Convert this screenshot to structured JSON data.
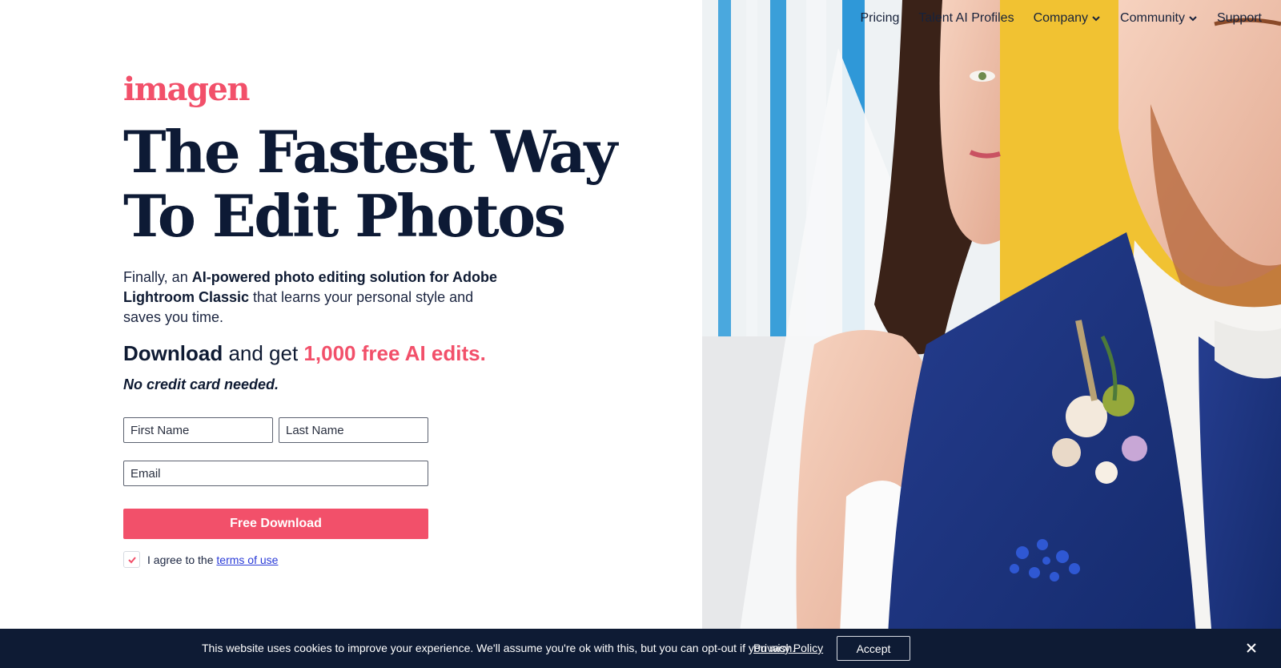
{
  "nav": {
    "items": [
      {
        "label": "Pricing",
        "dropdown": false
      },
      {
        "label": "Talent AI Profiles",
        "dropdown": false
      },
      {
        "label": "Company",
        "dropdown": true
      },
      {
        "label": "Community",
        "dropdown": true
      },
      {
        "label": "Support",
        "dropdown": false
      }
    ]
  },
  "brand": {
    "logo_text": "imagen",
    "accent_color": "#f2506a",
    "dark_color": "#0e1b34"
  },
  "hero": {
    "headline_line1": "The Fastest Way",
    "headline_line2": "To Edit Photos",
    "intro_part1": "Finally, an ",
    "intro_bold": "AI-powered photo editing solution for Adobe Lightroom Classic",
    "intro_part2": " that learns your personal style and saves you time.",
    "download_bold": "Download",
    "download_mid": " and get ",
    "download_accent": "1,000 free AI edits.",
    "no_credit_card": "No credit card needed."
  },
  "form": {
    "first_name_placeholder": "First Name",
    "last_name_placeholder": "Last Name",
    "email_placeholder": "Email",
    "submit_label": "Free Download",
    "agree_text": "I agree to the ",
    "terms_link": "terms of use",
    "agree_checked": true
  },
  "cookie_bar": {
    "message": "This website uses cookies to improve your experience. We'll assume you're ok with this, but you can opt-out if you wish.",
    "privacy_link": "Privacy Policy",
    "accept_label": "Accept",
    "close_icon": "close-icon"
  }
}
